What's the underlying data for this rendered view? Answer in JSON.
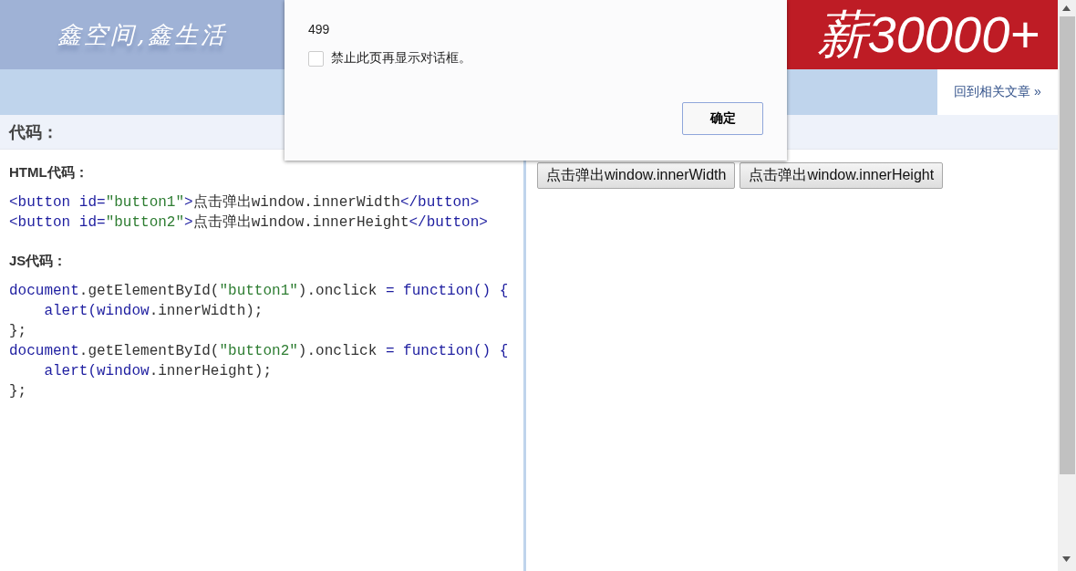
{
  "header": {
    "logo": "鑫空间,鑫生活",
    "banner": "薪30000+"
  },
  "nav": {
    "back_link": "回到相关文章 »"
  },
  "section_title": "代码：",
  "html_heading": "HTML代码：",
  "html_code": [
    {
      "indented": false,
      "tokens": [
        {
          "kind": "kw",
          "text": "<button"
        },
        {
          "kind": "kw",
          "text": " id="
        },
        {
          "kind": "str",
          "text": "\"button1\""
        },
        {
          "kind": "kw",
          "text": ">"
        },
        {
          "kind": "plain",
          "text": "点击弹出window.innerWidth"
        },
        {
          "kind": "kw",
          "text": "</button>"
        }
      ]
    },
    {
      "indented": false,
      "tokens": [
        {
          "kind": "kw",
          "text": "<button"
        },
        {
          "kind": "kw",
          "text": " id="
        },
        {
          "kind": "str",
          "text": "\"button2\""
        },
        {
          "kind": "kw",
          "text": ">"
        },
        {
          "kind": "plain",
          "text": "点击弹出window.innerHeight"
        },
        {
          "kind": "kw",
          "text": "</button>"
        }
      ]
    }
  ],
  "js_heading": "JS代码：",
  "js_code": [
    {
      "indented": false,
      "tokens": [
        {
          "kind": "kw",
          "text": "document"
        },
        {
          "kind": "plain",
          "text": ".getElementById("
        },
        {
          "kind": "str",
          "text": "\"button1\""
        },
        {
          "kind": "plain",
          "text": ").onclick "
        },
        {
          "kind": "kw",
          "text": "= function() {"
        }
      ]
    },
    {
      "indented": true,
      "tokens": [
        {
          "kind": "kw",
          "text": "alert(window"
        },
        {
          "kind": "plain",
          "text": ".innerWidth);"
        }
      ]
    },
    {
      "indented": false,
      "tokens": [
        {
          "kind": "plain",
          "text": "};"
        }
      ]
    },
    {
      "indented": false,
      "tokens": [
        {
          "kind": "kw",
          "text": "document"
        },
        {
          "kind": "plain",
          "text": ".getElementById("
        },
        {
          "kind": "str",
          "text": "\"button2\""
        },
        {
          "kind": "plain",
          "text": ").onclick "
        },
        {
          "kind": "kw",
          "text": "= function() {"
        }
      ]
    },
    {
      "indented": true,
      "tokens": [
        {
          "kind": "kw",
          "text": "alert(window"
        },
        {
          "kind": "plain",
          "text": ".innerHeight);"
        }
      ]
    },
    {
      "indented": false,
      "tokens": [
        {
          "kind": "plain",
          "text": "};"
        }
      ]
    }
  ],
  "demo_buttons": [
    "点击弹出window.innerWidth",
    "点击弹出window.innerHeight"
  ],
  "dialog": {
    "message": "499",
    "checkbox": {
      "label": "禁止此页再显示对话框。",
      "checked": false
    },
    "ok_button": "确定"
  }
}
